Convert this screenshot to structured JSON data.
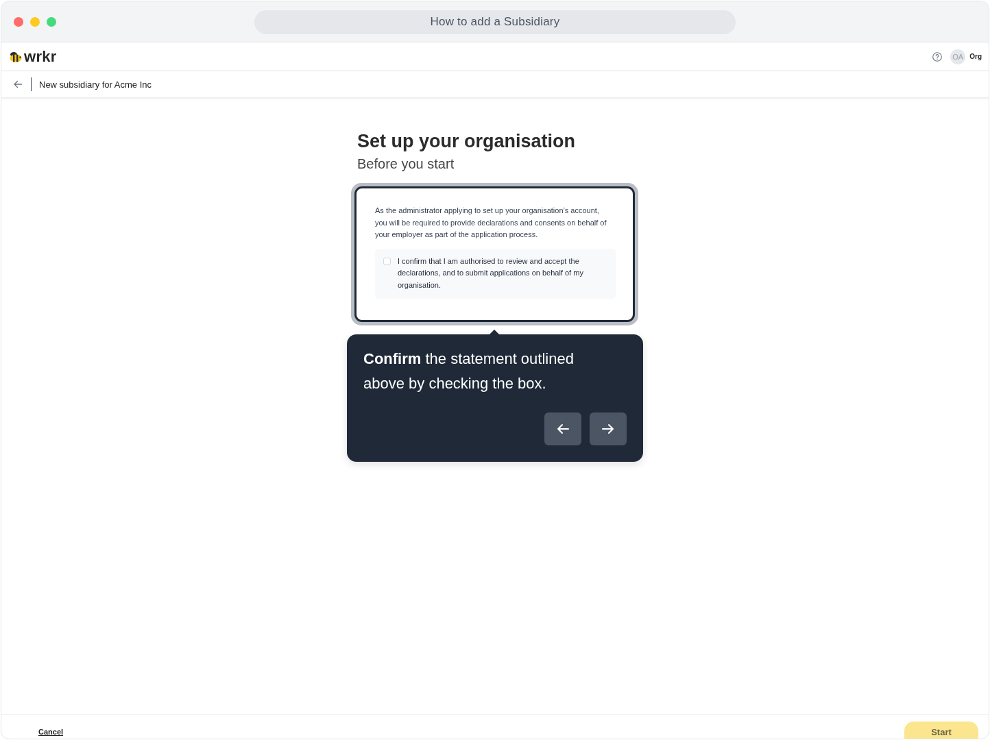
{
  "window": {
    "title": "How to add a Subsidiary"
  },
  "app_header": {
    "logo": "wrkr",
    "avatar_initials": "OA",
    "org_label": "Org"
  },
  "sub_header": {
    "title": "New subsidiary for Acme Inc"
  },
  "page": {
    "heading": "Set up your organisation",
    "subheading": "Before you start",
    "declaration_card": {
      "intro": "As the administrator applying to set up your organisation’s account, you will be required to provide declarations and consents on behalf of your employer as part of the application process.",
      "confirm": {
        "label": "I confirm that I am authorised to review and accept the declarations, and to submit applications on behalf of my organisation.",
        "checked": false
      }
    }
  },
  "tour_tooltip": {
    "text": "**Confirm** the statement outlined above by checking the box.",
    "nav_buttons": [
      {
        "kind": "back"
      },
      {
        "kind": "next"
      }
    ]
  },
  "footer": {
    "cancel": "Cancel",
    "start": {
      "label": "Start",
      "disabled": true
    }
  }
}
